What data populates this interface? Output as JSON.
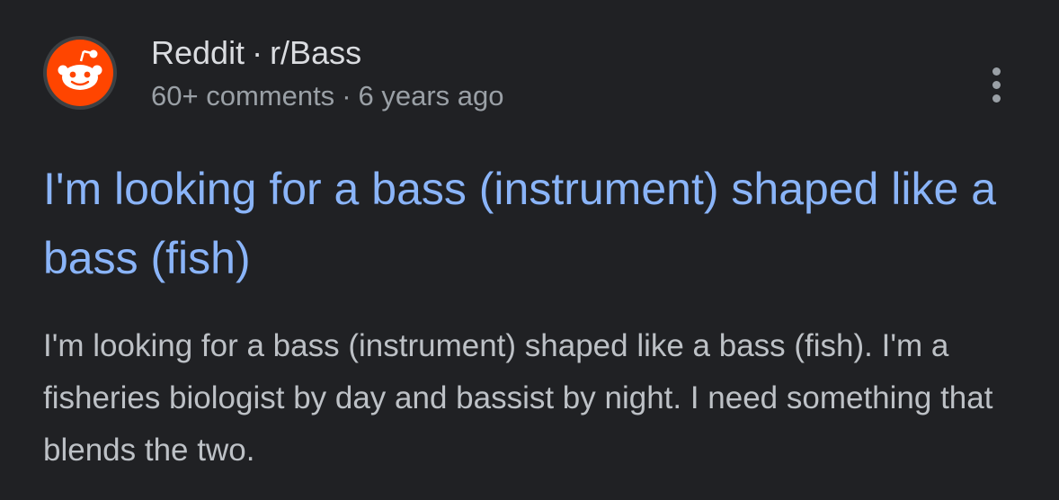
{
  "result": {
    "source_name": "Reddit",
    "separator": "·",
    "subreddit": "r/Bass",
    "comments": "60+ comments",
    "age": "6 years ago",
    "title": "I'm looking for a bass (instrument) shaped like a bass (fish)",
    "snippet": "I'm looking for a bass (instrument) shaped like a bass (fish). I'm a fisheries biologist by day and bassist by night. I need something that blends the two."
  },
  "colors": {
    "background": "#202124",
    "title_link": "#8ab4f8",
    "snippet_text": "#bdc1c6",
    "meta_text": "#9aa0a6",
    "reddit_orange": "#ff4500"
  },
  "icons": {
    "favicon": "reddit-snoo-icon",
    "more": "more-vert-icon"
  }
}
